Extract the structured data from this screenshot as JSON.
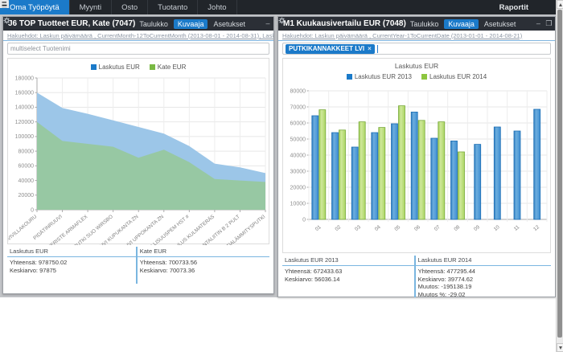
{
  "nav": {
    "items": [
      {
        "label": "Oma Työpöytä",
        "active": true
      },
      {
        "label": "Myynti",
        "active": false
      },
      {
        "label": "Osto",
        "active": false
      },
      {
        "label": "Tuotanto",
        "active": false
      },
      {
        "label": "Johto",
        "active": false
      }
    ],
    "reports_label": "Raportit",
    "icons": [
      "bar-chart-icon",
      "grid-icon",
      "save-icon",
      "menu-icon"
    ]
  },
  "panels": [
    {
      "title": "J6 TOP Tuotteet EUR, Kate (7047)",
      "tabs": [
        "Taulukko",
        "Kuvaaja",
        "Asetukset"
      ],
      "active_tab": "Kuvaaja",
      "conditions": "Hakuehdot: Laskun päivämäärä , CurrentMonth-12ToCurrentMonth (2013-08-01 - 2014-08-31), Laskutus EUR On eri kuin",
      "filter_placeholder": "multiselect Tuotenimi",
      "summary": [
        {
          "header": "Laskutus EUR",
          "lines": [
            "Yhteensä: 978750.02",
            "Keskiarvo: 97875"
          ]
        },
        {
          "header": "Kate EUR",
          "lines": [
            "Yhteensä: 700733.56",
            "Keskiarvo: 70073.36"
          ]
        }
      ]
    },
    {
      "title": "M1 Kuukausivertailu EUR (7048)",
      "tabs": [
        "Taulukko",
        "Kuvaaja",
        "Asetukset"
      ],
      "active_tab": "Kuvaaja",
      "conditions": "Hakuehdot: Laskun päivämäärä , CurrentYear-1ToCurrentDate (2013-01-01 - 2014-08-21)",
      "filter_chip": "PUTKIKANNAKKEET LVI",
      "summary": [
        {
          "header": "Laskutus EUR 2013",
          "lines": [
            "Yhteensä: 672433.63",
            "Keskiarvo: 56036.14"
          ]
        },
        {
          "header": "Laskutus EUR 2014",
          "lines": [
            "Yhteensä: 477295.44",
            "Keskiarvo: 39774.62",
            "Muutos: -195138.19",
            "Muutos %: -29.02"
          ]
        }
      ]
    }
  ],
  "colors": {
    "accent_blue": "#1b7ac9",
    "area_blue": "#9cc6e8",
    "area_green": "#97c8a3",
    "bar_blue": "#3f8ed2",
    "bar_green": "#abd563",
    "summary_rule": "#7ab6e0"
  },
  "chart_data": [
    {
      "type": "area",
      "title": "",
      "legend_position": "top",
      "grid": true,
      "categories": [
        "KIVIVILLAKOURU",
        "PIDÄTINRUUVI",
        "SOLUKUMIERISTE ARMAFLEX",
        "KYL- JA LÄMPÖJ.PUTKI SUO WIRSBO",
        "YLEISRUUVI KUPUKANTA ZN",
        "YLEISRUUVI UPPOKANTA ZN",
        "TEOLLISUUSPEM HST #",
        "HITSIKAULUS KULMATERÄS",
        "PANTALIITIN B 2 PULT",
        "LATTIALÄMMITYSPUTKI"
      ],
      "series": [
        {
          "name": "Laskutus EUR",
          "legend": "#1b7ac9",
          "fill": "#9cc6e8",
          "values": [
            160000,
            139000,
            131000,
            122000,
            113000,
            104000,
            87000,
            63000,
            58000,
            50000
          ]
        },
        {
          "name": "Kate EUR",
          "legend": "#79b943",
          "fill": "#97c8a3",
          "values": [
            120000,
            94000,
            90000,
            86000,
            71000,
            82000,
            65000,
            42000,
            40000,
            38000
          ]
        }
      ],
      "ylim": [
        0,
        180000
      ],
      "ystep": 20000
    },
    {
      "type": "bar",
      "title": "Laskutus EUR",
      "legend_position": "top",
      "grid": true,
      "categories": [
        "01",
        "02",
        "03",
        "04",
        "05",
        "06",
        "07",
        "08",
        "09",
        "10",
        "11",
        "12"
      ],
      "series": [
        {
          "name": "Laskutus EUR 2013",
          "legend": "#1b7ac9",
          "stroke": "#1d6fb5",
          "grad": [
            "#2e7cc0",
            "#6caede",
            "#3f8ed2"
          ],
          "values": [
            64500,
            54000,
            45000,
            54000,
            59500,
            66800,
            50500,
            48800,
            46700,
            57500,
            55000,
            68500
          ]
        },
        {
          "name": "Laskutus EUR 2014",
          "legend": "#8dc63f",
          "stroke": "#79aa3a",
          "grad": [
            "#9ccb52",
            "#cfe89a",
            "#abd563"
          ],
          "values": [
            68200,
            55600,
            60700,
            57200,
            70700,
            61600,
            60700,
            42000,
            null,
            null,
            null,
            null
          ]
        }
      ],
      "ylim": [
        0,
        80000
      ],
      "ystep": 10000
    }
  ]
}
